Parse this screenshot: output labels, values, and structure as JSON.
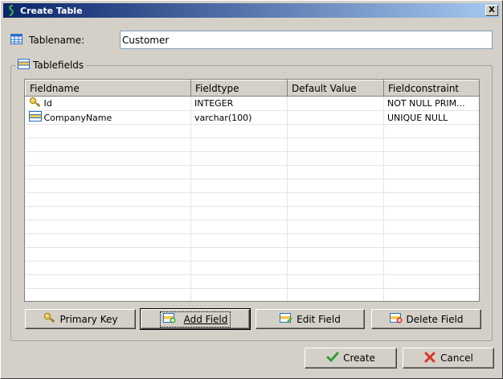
{
  "window": {
    "title": "Create Table",
    "close_glyph": "X"
  },
  "tablename": {
    "label": "Tablename:",
    "value": "Customer"
  },
  "tablefields": {
    "legend": "Tablefields",
    "columns": [
      "Fieldname",
      "Fieldtype",
      "Default Value",
      "Fieldconstraint"
    ],
    "rows": [
      {
        "icon": "key-icon",
        "fieldname": "Id",
        "fieldtype": "INTEGER",
        "default": "",
        "constraint": "NOT NULL PRIM..."
      },
      {
        "icon": "field-icon",
        "fieldname": "CompanyName",
        "fieldtype": "varchar(100)",
        "default": "",
        "constraint": "UNIQUE NULL"
      }
    ],
    "empty_rows": 13
  },
  "actions": {
    "primary_key": "Primary Key",
    "add_field": "Add Field",
    "edit_field": "Edit Field",
    "delete_field": "Delete Field"
  },
  "footer": {
    "create": "Create",
    "cancel": "Cancel"
  },
  "colors": {
    "title_start": "#0a246a",
    "title_end": "#a6caf0",
    "face": "#d4d0c8"
  }
}
